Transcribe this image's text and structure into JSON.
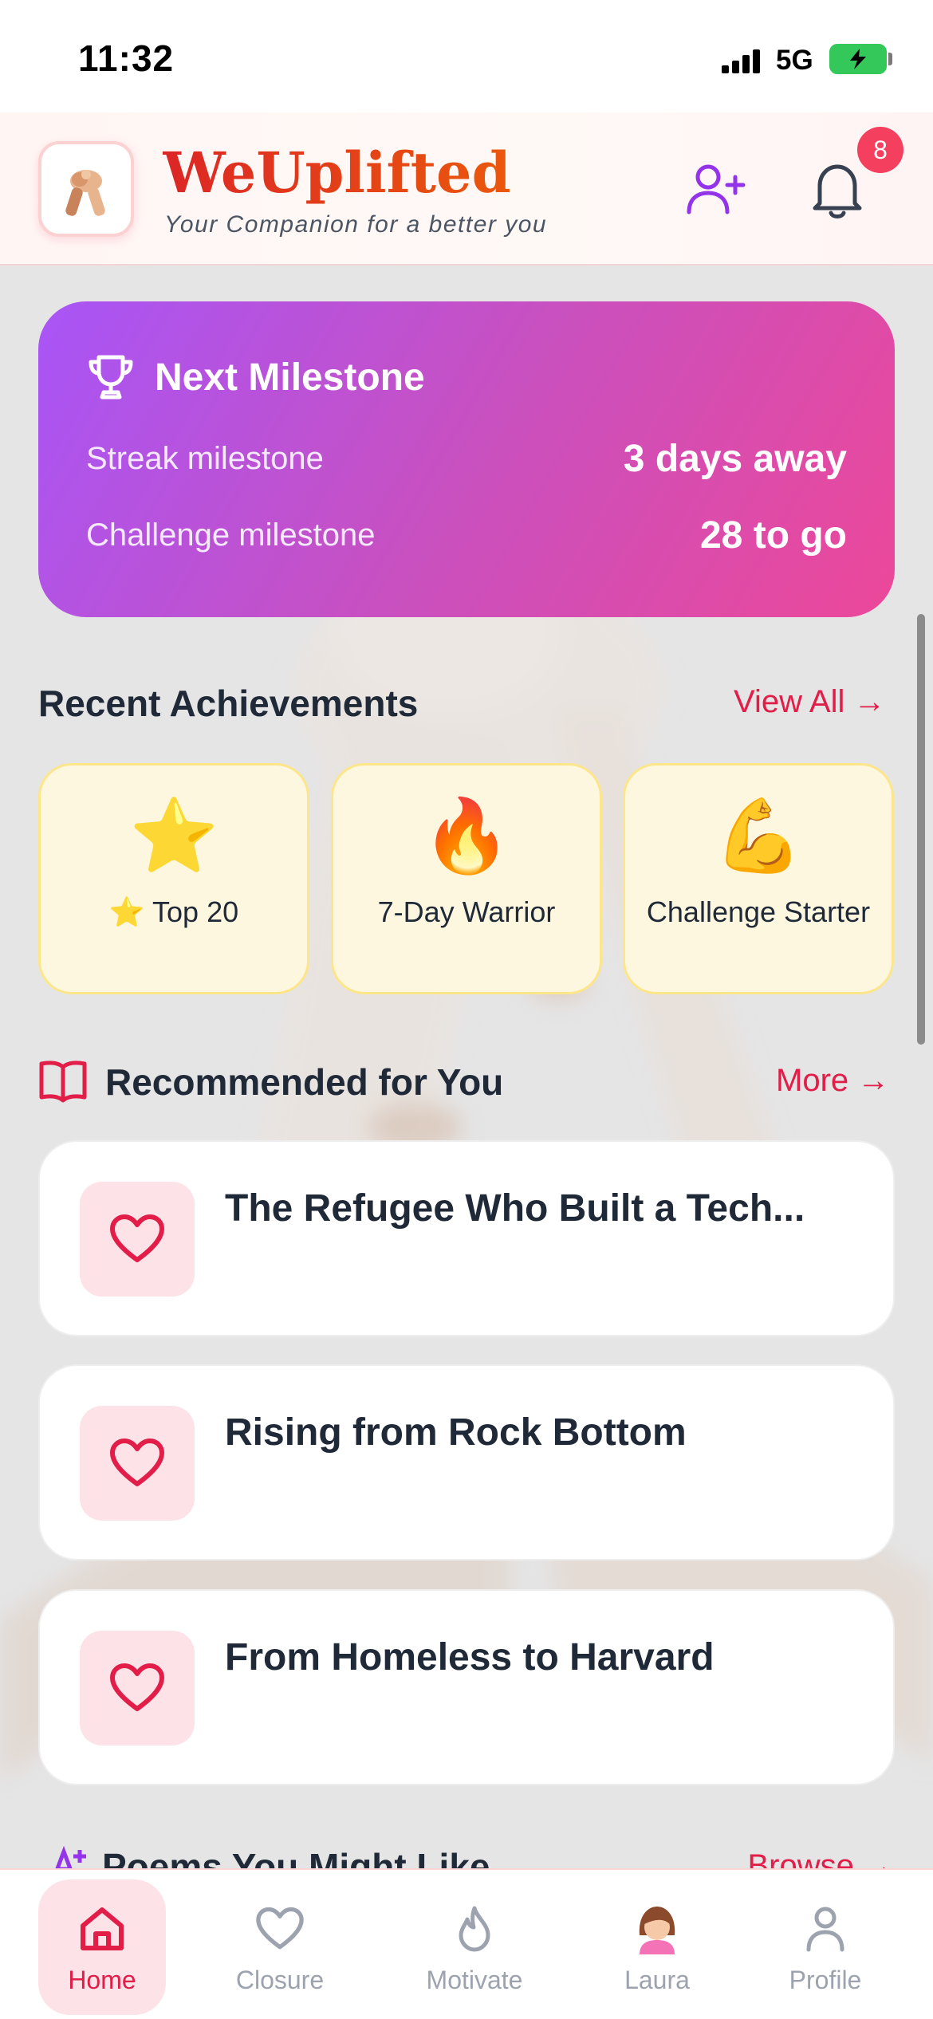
{
  "status_bar": {
    "time": "11:32",
    "network": "5G"
  },
  "header": {
    "brand": "WeUplifted",
    "tagline": "Your Companion for a better you",
    "notification_count": "8",
    "accent": "#e11d48"
  },
  "milestone": {
    "title": "Next Milestone",
    "rows": [
      {
        "label": "Streak milestone",
        "value": "3 days away"
      },
      {
        "label": "Challenge milestone",
        "value": "28 to go"
      }
    ]
  },
  "achievements": {
    "title": "Recent Achievements",
    "link": "View All →",
    "items": [
      {
        "emoji": "⭐",
        "label": "⭐ Top 20"
      },
      {
        "emoji": "🔥",
        "label": "7-Day Warrior"
      },
      {
        "emoji": "💪",
        "label": "Challenge Starter"
      }
    ]
  },
  "recommended": {
    "title": "Recommended for You",
    "link": "More →",
    "items": [
      {
        "title": "The Refugee Who Built a Tech..."
      },
      {
        "title": "Rising from Rock Bottom"
      },
      {
        "title": "From Homeless to Harvard"
      }
    ]
  },
  "next_section": {
    "title": "Poems You Might Like",
    "link": "Browse →"
  },
  "bottom_nav": {
    "items": [
      {
        "label": "Home",
        "icon": "home-icon",
        "active": true
      },
      {
        "label": "Closure",
        "icon": "heart-icon"
      },
      {
        "label": "Motivate",
        "icon": "flame-icon"
      },
      {
        "label": "Laura",
        "icon": "avatar-icon"
      },
      {
        "label": "Profile",
        "icon": "user-icon"
      }
    ]
  }
}
